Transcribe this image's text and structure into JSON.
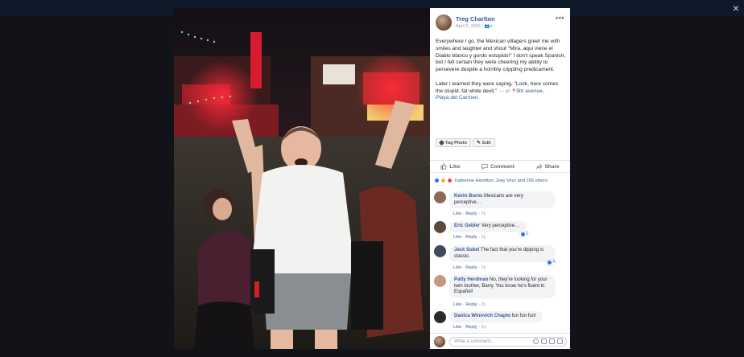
{
  "post": {
    "author": "Treg Charlton",
    "date": "April 2, 2016",
    "audience_glyph": "👥▾",
    "more_glyph": "•••",
    "text_p1": "Everywhere I go, the Mexican villagers greet me with smiles and laughter and shout \"Mira, aqui viene el Diablo blanco y gordo estupido!\" I don't speak Spanish, but I felt certain they were cheering my ability to persevere despite a horribly crippling predicament.",
    "text_p2_main": "Later I learned they were saying, \"Look, here comes the stupid, fat white devil.\"",
    "text_p2_at": " — at ",
    "location_pin": "📍",
    "location_line1": "5th avenue,",
    "location_line2": "Playa del Carmen",
    "location_tail": "."
  },
  "photo_tools": {
    "tag_photo": "Tag Photo",
    "edit": "Edit"
  },
  "actions": {
    "like": "Like",
    "comment": "Comment",
    "share": "Share"
  },
  "reactions": {
    "summary": "Katherine Hamilton, Joey Vinci and 165 others"
  },
  "comments": [
    {
      "name": "Kevin Burns",
      "text": "Mexicans are very perceptive…",
      "like": "Like",
      "reply": "Reply",
      "age": "2y",
      "avatar_color": "#8a6a55"
    },
    {
      "name": "Eric Gebler",
      "text": "Very perceptive…",
      "like": "Like",
      "reply": "Reply",
      "age": "2y",
      "reaction_count": "1",
      "avatar_color": "#5a4a3e"
    },
    {
      "name": "Jack Subel",
      "text": "The fact that you're dipping is classic.",
      "like": "Like",
      "reply": "Reply",
      "age": "2y",
      "reaction_count": "4",
      "avatar_color": "#3f4b57"
    },
    {
      "name": "Patty Herdman",
      "text": "No, they're looking for your twin brother, Barry. You know he's fluent in Español!",
      "like": "Like",
      "reply": "Reply",
      "age": "2y",
      "avatar_color": "#c79a80"
    },
    {
      "name": "Danica Winovich Chaplo",
      "text": "fun fun fun!",
      "like": "Like",
      "reply": "Reply",
      "age": "2y",
      "avatar_color": "#2c2a2a"
    }
  ],
  "composer": {
    "placeholder": "Write a comment..."
  },
  "colors": {
    "link": "#385898",
    "like_blue": "#2078f4",
    "overlay": "#111318"
  },
  "icons": {
    "close": "×"
  }
}
